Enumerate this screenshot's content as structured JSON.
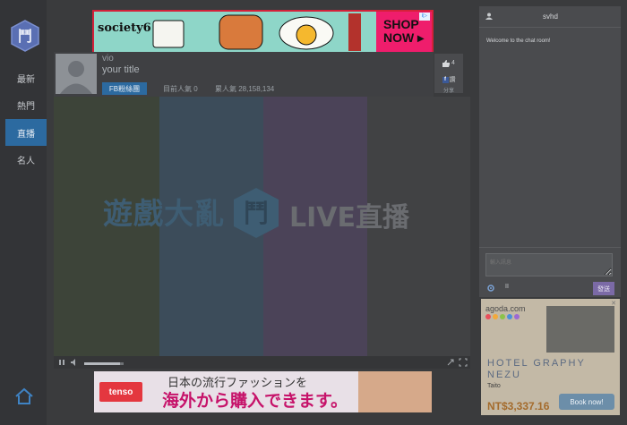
{
  "sidebar": {
    "logo_icon": "fight-logo-icon",
    "items": [
      {
        "label": "最新"
      },
      {
        "label": "熱門"
      },
      {
        "label": "直播"
      },
      {
        "label": "名人"
      }
    ],
    "home_icon": "home-icon",
    "accent": "#2c6aa0"
  },
  "ad_top": {
    "brand": "society6",
    "cta_line1": "SHOP",
    "cta_line2": "NOW ▸",
    "badge": "i▷"
  },
  "player": {
    "username": "vio",
    "title": "your title",
    "fan_button": "FB粉絲團",
    "current_viewers": "目前人氣 0",
    "total_viewers": "累人氣 28,158,134",
    "like_count": "4",
    "share_label": "分享",
    "fb_label": "讚"
  },
  "stream": {
    "watermark_text": "遊戲大亂",
    "watermark_live": "LIVE直播",
    "bar_colors": [
      "#3d4439",
      "#3c4c5a",
      "#4b4358",
      "#414244"
    ],
    "volume_level": 0.9
  },
  "ad_bottom": {
    "brand": "tenso",
    "line1": "日本の流行ファッションを",
    "line2": "海外から購入できます。"
  },
  "chat": {
    "username": "svhd",
    "welcome": "Welcome to the chat room!",
    "input_placeholder": "輸入訊息",
    "send_label": "發送",
    "tool_label": "II"
  },
  "ad_side": {
    "brand": "agoda.com",
    "hotel": "HOTEL GRAPHY NEZU",
    "city": "Taito",
    "price": "NT$3,337.16",
    "cta": "Book now!",
    "dot_colors": [
      "#e8505b",
      "#f2a93b",
      "#8bc34a",
      "#4a90d9",
      "#9c6ad3"
    ]
  }
}
